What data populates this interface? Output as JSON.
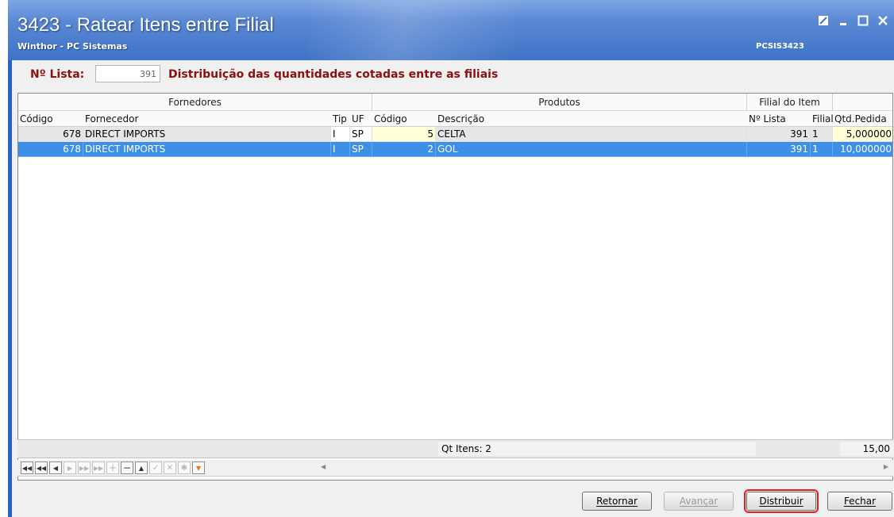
{
  "window": {
    "title": "3423 - Ratear Itens entre Filial",
    "subtitle": "Winthor - PC Sistemas",
    "app_code": "PCSIS3423"
  },
  "header": {
    "lista_label": "Nº Lista:",
    "lista_value": "391",
    "description": "Distribuição das quantidades cotadas entre as filiais"
  },
  "grid": {
    "bands": [
      "Fornedores",
      "Produtos",
      "Filial do Item"
    ],
    "columns": [
      "Código",
      "Fornecedor",
      "Tip",
      "UF",
      "Código",
      "Descrição",
      "Nº Lista",
      "Filial",
      "Qtd.Pedida"
    ],
    "rows": [
      [
        "678",
        "DIRECT IMPORTS",
        "I",
        "SP",
        "5",
        "CELTA",
        "391",
        "1",
        "5,000000"
      ],
      [
        "678",
        "DIRECT IMPORTS",
        "I",
        "SP",
        "2",
        "GOL",
        "391",
        "1",
        "10,000000"
      ]
    ],
    "selected_row": 2,
    "footer": {
      "count": "Qt Itens: 2",
      "total": "15,00"
    }
  },
  "buttons": {
    "retornar": "Retornar",
    "avancar": "Avançar",
    "distribuir": "Distribuir",
    "fechar": "Fechar"
  },
  "colors": {
    "title_bg": "#3f73c7",
    "selected_row": "#3d8fe8",
    "heading_text": "#8b1010",
    "focus_outline": "#e02020"
  }
}
